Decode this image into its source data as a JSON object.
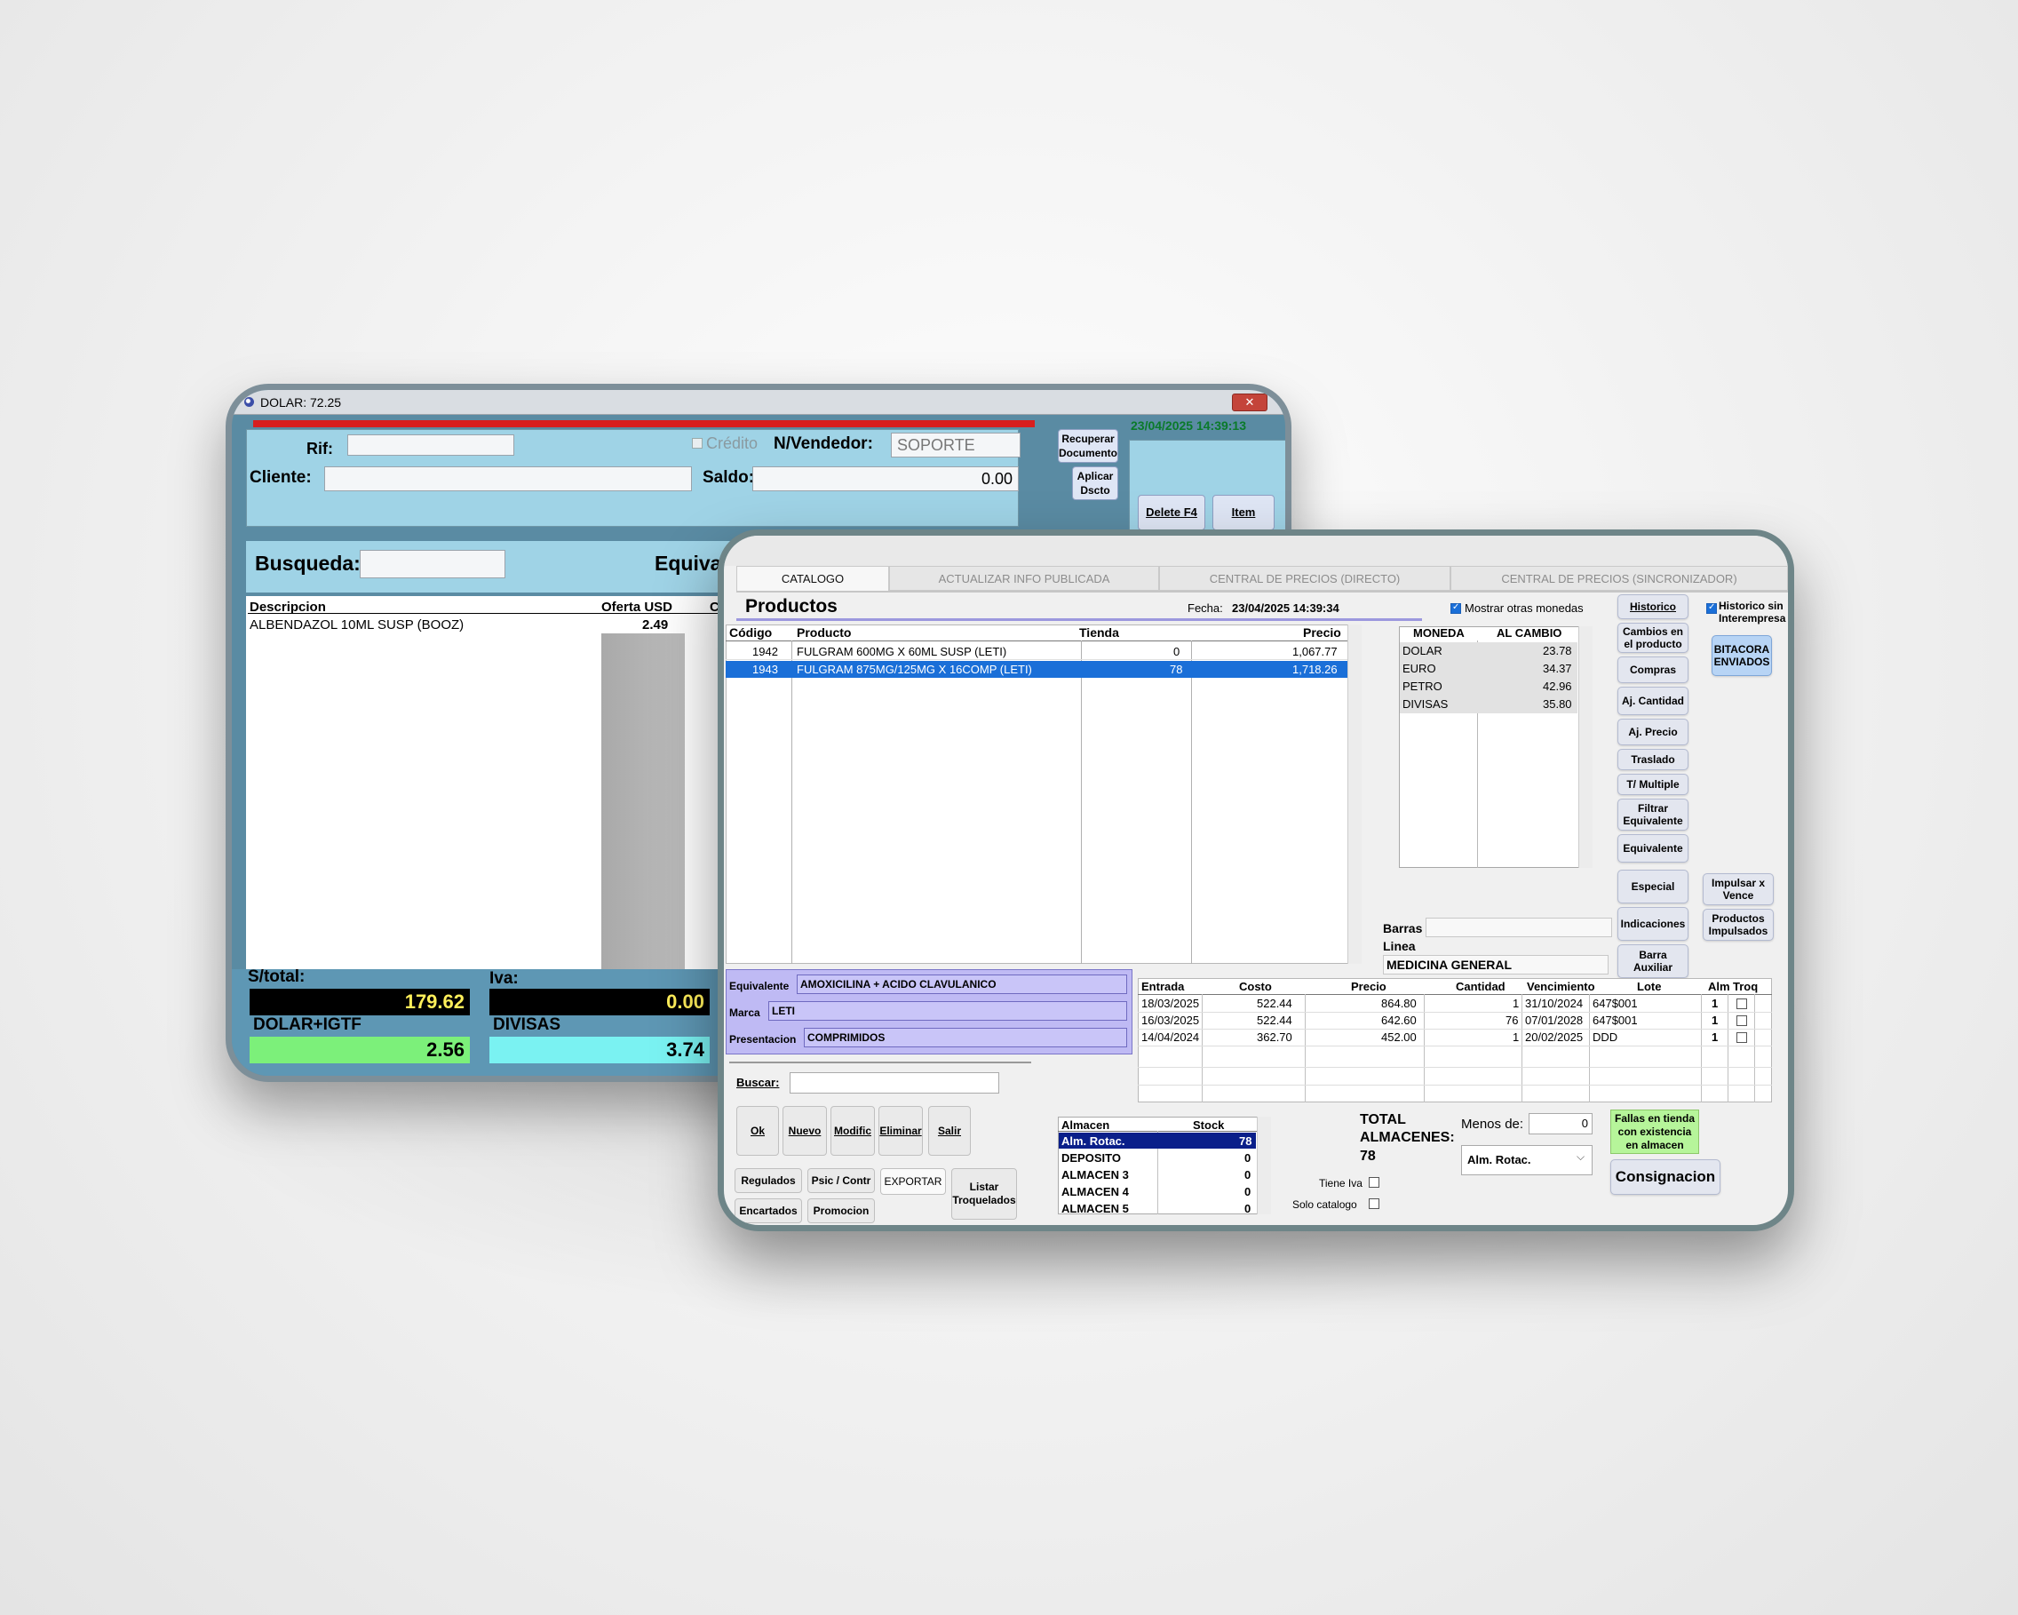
{
  "pos": {
    "title": "DOLAR: 72.25",
    "close_glyph": "✕",
    "datetime": "23/04/2025 14:39:13",
    "rif_label": "Rif:",
    "rif_value": "",
    "credito_label": "Crédito",
    "vendedor_label": "N/Vendedor:",
    "vendedor_value": "SOPORTE",
    "cliente_label": "Cliente:",
    "saldo_label": "Saldo:",
    "saldo_value": "0.00",
    "recuperar_label": "Recuperar Documento",
    "aplicar_label": "Aplicar Dscto",
    "delete_label": "Delete F4",
    "item_label": "Item",
    "busqueda_label": "Busqueda:",
    "equival_label": "Equival",
    "columns": [
      "Descripcion",
      "Oferta USD",
      "C"
    ],
    "rows": [
      {
        "descripcion": "ALBENDAZOL 10ML SUSP (BOOZ)",
        "oferta": "2.49"
      }
    ],
    "stotal_label": "S/total:",
    "stotal_value": "179.62",
    "iva_label": "Iva:",
    "iva_value": "0.00",
    "dolar_igtf_label": "DOLAR+IGTF",
    "dolar_igtf_value": "2.56",
    "divisas_label": "DIVISAS",
    "divisas_value": "3.74",
    "colors": {
      "red_bar": "#d81e1e",
      "green_box": "#7cf07a",
      "cyan_box": "#7af2f2"
    }
  },
  "catalog": {
    "tabs": [
      {
        "label": "CATALOGO",
        "active": true
      },
      {
        "label": "ACTUALIZAR INFO PUBLICADA",
        "active": false
      },
      {
        "label": "CENTRAL DE PRECIOS (DIRECTO)",
        "active": false
      },
      {
        "label": "CENTRAL DE PRECIOS (SINCRONIZADOR)",
        "active": false
      }
    ],
    "title": "Productos",
    "fecha_label": "Fecha:",
    "fecha_value": "23/04/2025 14:39:34",
    "mostrar_label": "Mostrar otras monedas",
    "historico_sin_label": "Historico sin Interempresa",
    "columns": [
      "Código",
      "Producto",
      "Tienda",
      "Precio"
    ],
    "products": [
      {
        "codigo": "1942",
        "producto": "FULGRAM 600MG X 60ML SUSP (LETI)",
        "tienda": "0",
        "precio": "1,067.77",
        "selected": false
      },
      {
        "codigo": "1943",
        "producto": "FULGRAM 875MG/125MG X 16COMP (LETI)",
        "tienda": "78",
        "precio": "1,718.26",
        "selected": true
      }
    ],
    "currency_cols": [
      "MONEDA",
      "AL CAMBIO"
    ],
    "currencies": [
      {
        "moneda": "DOLAR",
        "cambio": "23.78"
      },
      {
        "moneda": "EURO",
        "cambio": "34.37"
      },
      {
        "moneda": "PETRO",
        "cambio": "42.96"
      },
      {
        "moneda": "DIVISAS",
        "cambio": "35.80"
      }
    ],
    "side_buttons": [
      "Historico",
      "Cambios en el producto",
      "Compras",
      "Aj. Cantidad",
      "Aj. Precio",
      "Traslado",
      "T/ Multiple",
      "Filtrar Equivalente",
      "Equivalente",
      "Especial",
      "Indicaciones",
      "Barra Auxiliar"
    ],
    "bitacora_label": "BITACORA ENVIADOS",
    "impulsar_label": "Impulsar x Vence",
    "impulsados_label": "Productos Impulsados",
    "barras_label": "Barras",
    "linea_label": "Linea",
    "linea_value": "MEDICINA GENERAL",
    "equivalente_label": "Equivalente",
    "equivalente_value": "AMOXICILINA + ACIDO CLAVULANICO",
    "marca_label": "Marca",
    "marca_value": "LETI",
    "presentacion_label": "Presentacion",
    "presentacion_value": "COMPRIMIDOS",
    "entries_cols": [
      "Entrada",
      "Costo",
      "Precio",
      "Cantidad",
      "Vencimiento",
      "Lote",
      "Alm",
      "Troq"
    ],
    "entries": [
      {
        "entrada": "18/03/2025",
        "costo": "522.44",
        "precio": "864.80",
        "cantidad": "1",
        "vencimiento": "31/10/2024",
        "lote": "647$001",
        "alm": "1"
      },
      {
        "entrada": "16/03/2025",
        "costo": "522.44",
        "precio": "642.60",
        "cantidad": "76",
        "vencimiento": "07/01/2028",
        "lote": "647$001",
        "alm": "1"
      },
      {
        "entrada": "14/04/2024",
        "costo": "362.70",
        "precio": "452.00",
        "cantidad": "1",
        "vencimiento": "20/02/2025",
        "lote": "DDD",
        "alm": "1"
      }
    ],
    "buscar_label": "Buscar:",
    "buttons_row1": [
      "Ok",
      "Nuevo",
      "Modific",
      "Eliminar",
      "Salir"
    ],
    "regulados_label": "Regulados",
    "psic_label": "Psic / Contr",
    "exportar_label": "EXPORTAR",
    "listar_label": "Listar Troquelados",
    "encartados_label": "Encartados",
    "promocion_label": "Promocion",
    "almacen_cols": [
      "Almacen",
      "Stock"
    ],
    "almacenes": [
      {
        "nombre": "Alm. Rotac.",
        "stock": "78",
        "selected": true
      },
      {
        "nombre": "DEPOSITO",
        "stock": "0",
        "selected": false
      },
      {
        "nombre": "ALMACEN 3",
        "stock": "0",
        "selected": false
      },
      {
        "nombre": "ALMACEN 4",
        "stock": "0",
        "selected": false
      },
      {
        "nombre": "ALMACEN 5",
        "stock": "0",
        "selected": false
      }
    ],
    "total_label": "TOTAL ALMACENES:",
    "total_value": "78",
    "menos_label": "Menos de:",
    "menos_value": "0",
    "tiene_iva_label": "Tiene Iva",
    "solo_catalogo_label": "Solo catalogo",
    "alm_select_value": "Alm. Rotac.",
    "fallas_label": "Fallas en tienda con existencia en almacen",
    "consignacion_label": "Consignacion",
    "colors": {
      "selection": "#1a6fd8",
      "lilac": "#bfbaf4",
      "green_note": "#b6f59a",
      "navy_sel": "#0a1f8a"
    }
  }
}
